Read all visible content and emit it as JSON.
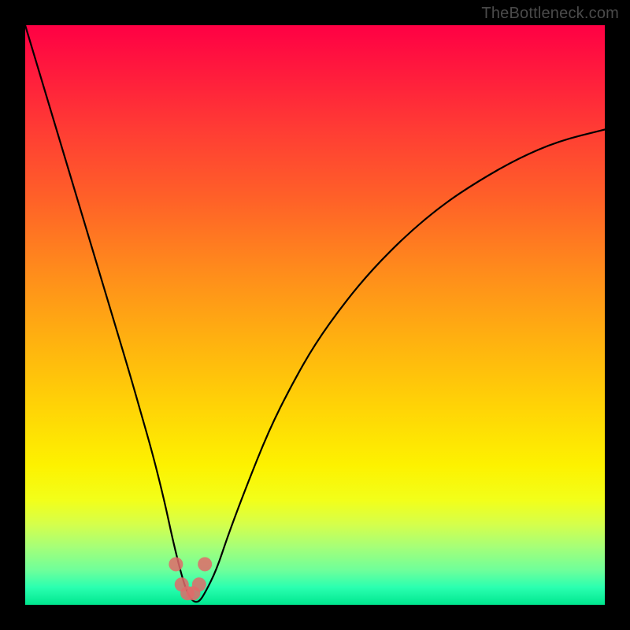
{
  "watermark": "TheBottleneck.com",
  "chart_data": {
    "type": "line",
    "title": "",
    "xlabel": "",
    "ylabel": "",
    "xlim": [
      0,
      100
    ],
    "ylim": [
      0,
      100
    ],
    "x": [
      0,
      3,
      6,
      9,
      12,
      15,
      18,
      20,
      22,
      24,
      25.5,
      27,
      28,
      29,
      30,
      31,
      33,
      35,
      38,
      42,
      46,
      50,
      55,
      60,
      66,
      72,
      78,
      85,
      92,
      100
    ],
    "y": [
      100,
      90,
      80,
      70,
      60,
      50,
      40,
      33,
      26,
      18,
      11,
      5,
      2,
      0.5,
      0.5,
      2,
      6,
      12,
      20,
      30,
      38,
      45,
      52,
      58,
      64,
      69,
      73,
      77,
      80,
      82
    ],
    "markers": {
      "x": [
        26.0,
        27.0,
        28.0,
        29.0,
        30.0,
        31.0
      ],
      "y": [
        7.0,
        3.5,
        2.0,
        2.0,
        3.5,
        7.0
      ]
    },
    "gradient_colormap": "rainbow (red-top to green-bottom)"
  }
}
